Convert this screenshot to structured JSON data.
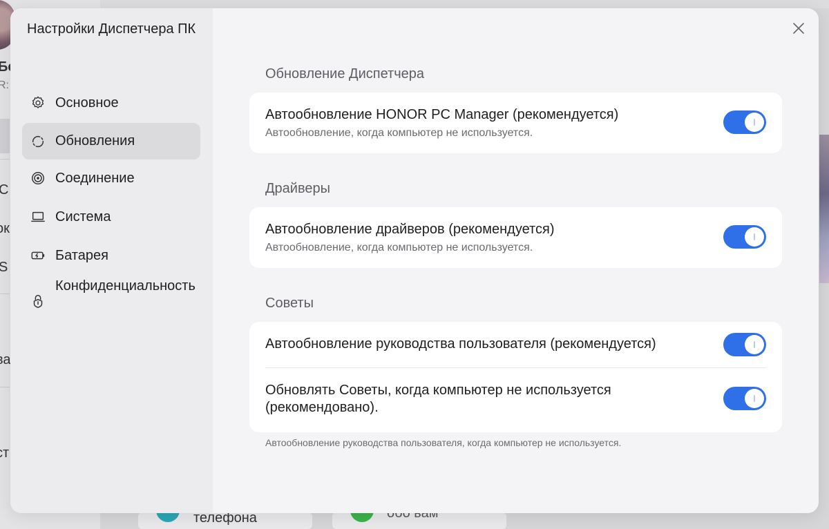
{
  "background": {
    "fragments": [
      "Бе",
      "R:",
      "C",
      "ок",
      "S",
      "ва",
      "ст"
    ],
    "bottom_labels": [
      "телефона",
      "обо ьам"
    ]
  },
  "dialog": {
    "title": "Настройки Диспетчера ПК",
    "close_icon": "close-icon"
  },
  "sidebar": {
    "items": [
      {
        "label": "Основное",
        "icon": "gear-icon",
        "active": false
      },
      {
        "label": "Обновления",
        "icon": "refresh-icon",
        "active": true
      },
      {
        "label": "Соединение",
        "icon": "connection-icon",
        "active": false
      },
      {
        "label": "Система",
        "icon": "laptop-icon",
        "active": false
      },
      {
        "label": "Батарея",
        "icon": "battery-icon",
        "active": false
      },
      {
        "label": "Конфиденциальность",
        "icon": "lock-icon",
        "active": false
      }
    ]
  },
  "sections": [
    {
      "title": "Обновление Диспетчера",
      "rows": [
        {
          "title": "Автообновление HONOR PC Manager (рекомендуется)",
          "subtitle": "Автообновление, когда компьютер не используется.",
          "enabled": true
        }
      ]
    },
    {
      "title": "Драйверы",
      "rows": [
        {
          "title": "Автообновление драйверов (рекомендуется)",
          "subtitle": "Автообновление, когда компьютер не используется.",
          "enabled": true
        }
      ]
    },
    {
      "title": "Советы",
      "rows": [
        {
          "title": "Автообновление руководства пользователя (рекомендуется)",
          "enabled": true
        },
        {
          "title": "Обновлять Советы, когда компьютер не используется (рекомендовано).",
          "enabled": true
        }
      ],
      "footnote": "Автообновление руководства пользователя, когда компьютер не используется."
    }
  ],
  "colors": {
    "accent": "#2f6fe8",
    "sidebar_bg": "#ececee",
    "content_bg": "#f4f4f7",
    "active_item_bg": "#dbdbde"
  }
}
